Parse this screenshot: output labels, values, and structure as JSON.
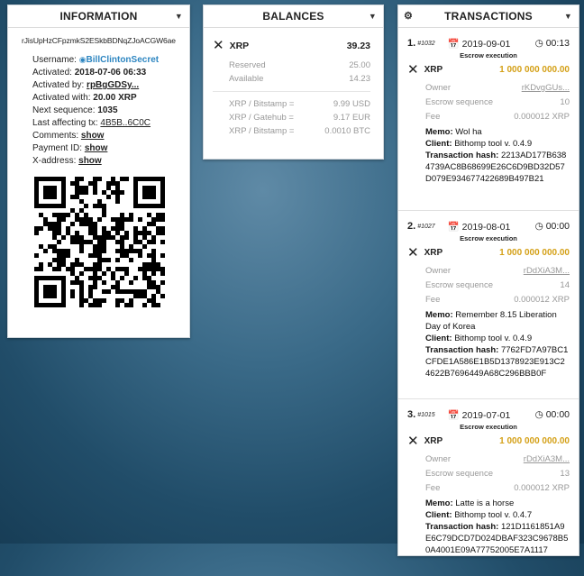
{
  "information": {
    "title": "INFORMATION",
    "address": "rJisUpHzCFpzmkS2ESkbBDNqZJoACGW6ae",
    "username_label": "Username:",
    "username": "BillClintonSecret",
    "activated_label": "Activated:",
    "activated": "2018-07-06 06:33",
    "activated_by_label": "Activated by:",
    "activated_by": "rpBgGDSy...",
    "activated_with_label": "Activated with:",
    "activated_with": "20.00 XRP",
    "next_sequence_label": "Next sequence:",
    "next_sequence": "1035",
    "last_tx_label": "Last affecting tx:",
    "last_tx": "4B5B..6C0C",
    "comments_label": "Comments:",
    "comments": "show",
    "payment_id_label": "Payment ID:",
    "payment_id": "show",
    "xaddress_label": "X-address:",
    "xaddress": "show"
  },
  "balances": {
    "title": "BALANCES",
    "currency": "XRP",
    "amount": "39.23",
    "rows": [
      {
        "label": "Reserved",
        "value": "25.00"
      },
      {
        "label": "Available",
        "value": "14.23"
      }
    ],
    "rates": [
      {
        "label": "XRP / Bitstamp =",
        "value": "9.99 USD"
      },
      {
        "label": "XRP / Gatehub =",
        "value": "9.17 EUR"
      },
      {
        "label": "XRP / Bitstamp =",
        "value": "0.0010 BTC"
      }
    ]
  },
  "transactions": {
    "title": "TRANSACTIONS",
    "items": [
      {
        "num": "1.",
        "id": "#1032",
        "date": "2019-09-01",
        "time": "00:13",
        "type": "Escrow execution",
        "currency": "XRP",
        "amount": "1 000 000 000.00",
        "owner_label": "Owner",
        "owner": "rKDvgGUs...",
        "seq_label": "Escrow sequence",
        "seq": "10",
        "fee_label": "Fee",
        "fee": "0.000012 XRP",
        "memo_label": "Memo:",
        "memo": "Wol ha",
        "client_label": "Client:",
        "client": "Bithomp tool v. 0.4.9",
        "hash_label": "Transaction hash:",
        "hash": "2213AD177B6384739AC8B68699E26C6D9BD32D57D079E934677422689B497B21"
      },
      {
        "num": "2.",
        "id": "#1027",
        "date": "2019-08-01",
        "time": "00:00",
        "type": "Escrow execution",
        "currency": "XRP",
        "amount": "1 000 000 000.00",
        "owner_label": "Owner",
        "owner": "rDdXiA3M...",
        "seq_label": "Escrow sequence",
        "seq": "14",
        "fee_label": "Fee",
        "fee": "0.000012 XRP",
        "memo_label": "Memo:",
        "memo": "Remember 8.15 Liberation Day of Korea",
        "client_label": "Client:",
        "client": "Bithomp tool v. 0.4.9",
        "hash_label": "Transaction hash:",
        "hash": "7762FD7A97BC1CFDE1A586E1B5D1378923E913C24622B7696449A68C296BBB0F"
      },
      {
        "num": "3.",
        "id": "#1015",
        "date": "2019-07-01",
        "time": "00:00",
        "type": "Escrow execution",
        "currency": "XRP",
        "amount": "1 000 000 000.00",
        "owner_label": "Owner",
        "owner": "rDdXiA3M...",
        "seq_label": "Escrow sequence",
        "seq": "13",
        "fee_label": "Fee",
        "fee": "0.000012 XRP",
        "memo_label": "Memo:",
        "memo": "Latte is a horse",
        "client_label": "Client:",
        "client": "Bithomp tool v. 0.4.7",
        "hash_label": "Transaction hash:",
        "hash": "121D1161851A9E6C79DCD7D024DBAF323C9678B50A4001E09A77752005E7A1117"
      }
    ]
  }
}
